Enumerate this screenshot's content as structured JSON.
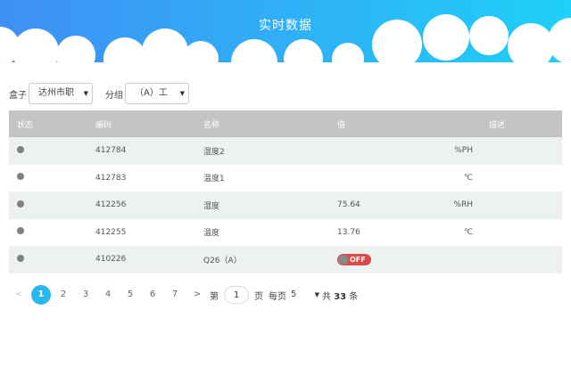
{
  "header": {
    "title": "实时数据"
  },
  "filters": {
    "box_label": "盒子",
    "box_value": "达州市职",
    "group_label": "分组",
    "group_value": "（A）工"
  },
  "table": {
    "columns": [
      "状态",
      "编码",
      "名称",
      "值",
      "描述"
    ],
    "rows": [
      {
        "code": "412784",
        "name": "湿度2",
        "value": "",
        "unit": "%PH"
      },
      {
        "code": "412783",
        "name": "温度1",
        "value": "",
        "unit": "℃"
      },
      {
        "code": "412256",
        "name": "湿度",
        "value": "75.64",
        "unit": "%RH"
      },
      {
        "code": "412255",
        "name": "温度",
        "value": "13.76",
        "unit": "℃"
      },
      {
        "code": "410226",
        "name": "Q26（A）",
        "value": "",
        "unit": "",
        "toggle": "OFF"
      }
    ]
  },
  "pagination": {
    "prev": "<",
    "next": ">",
    "pages": [
      "1",
      "2",
      "3",
      "4",
      "5",
      "6",
      "7"
    ],
    "current": "1",
    "goto_prefix": "第",
    "goto_value": "1",
    "goto_suffix": "页",
    "per_page_label": "每页",
    "per_page_value": "5",
    "total_prefix": "共",
    "total_count": "33",
    "total_suffix": "条"
  },
  "colors": {
    "header_gradient_start": "#3f8ff5",
    "header_gradient_end": "#1fd0f7",
    "table_header": "#c4c4c4",
    "active_page": "#28b8f0",
    "toggle_off": "#d94a4a"
  }
}
